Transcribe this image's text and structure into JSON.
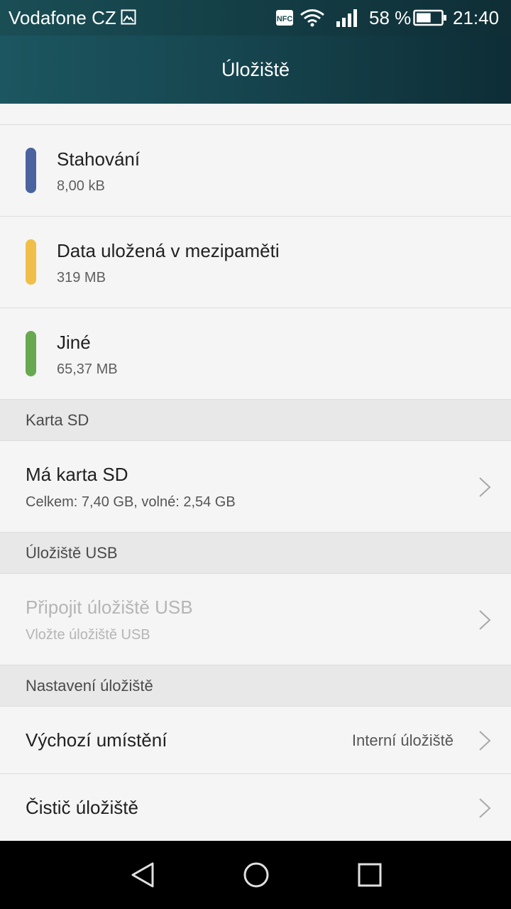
{
  "status_bar": {
    "carrier": "Vodafone CZ",
    "battery_percent": "58 %",
    "battery_level": 0.58,
    "time": "21:40",
    "icons": [
      "image-icon",
      "nfc-icon",
      "wifi-icon",
      "signal-icon",
      "battery-icon"
    ]
  },
  "app_bar": {
    "title": "Úložiště"
  },
  "categories": [
    {
      "name": "Stahování",
      "size": "8,00 kB",
      "color": "#4a63a0"
    },
    {
      "name": "Data uložená v mezipaměti",
      "size": "319 MB",
      "color": "#f0bf4a"
    },
    {
      "name": "Jiné",
      "size": "65,37 MB",
      "color": "#68a850"
    }
  ],
  "sd_section": {
    "header": "Karta SD",
    "item": {
      "title": "Má karta SD",
      "subtitle": "Celkem: 7,40 GB, volné: 2,54 GB"
    }
  },
  "usb_section": {
    "header": "Úložiště USB",
    "item": {
      "title": "Připojit úložiště USB",
      "subtitle": "Vložte úložiště USB",
      "enabled": false
    }
  },
  "settings_section": {
    "header": "Nastavení úložiště",
    "default_location": {
      "title": "Výchozí umístění",
      "value": "Interní úložiště"
    },
    "cleaner": {
      "title": "Čistič úložiště"
    }
  },
  "nav_bar": {
    "buttons": [
      "back-icon",
      "home-icon",
      "recents-icon"
    ]
  },
  "colors": {
    "app_bar": "#174852",
    "background": "#f5f5f5",
    "section_header": "#e8e8e8"
  }
}
